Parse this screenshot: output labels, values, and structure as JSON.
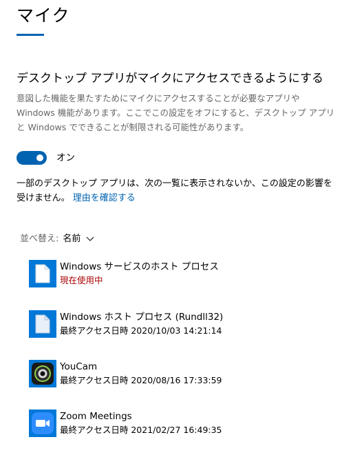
{
  "page": {
    "title": "マイク"
  },
  "desktop_access": {
    "heading": "デスクトップ アプリがマイクにアクセスできるようにする",
    "description": "意図した機能を果たすためにマイクにアクセスすることが必要なアプリや Windows 機能があります。ここでこの設定をオフにすると、デスクトップ アプリと Windows でできることが制限される可能性があります。",
    "toggle_state": "オン",
    "toggle_on": true,
    "note_text": "一部のデスクトップ アプリは、次の一覧に表示されないか、この設定の影響を受けません。",
    "note_link": "理由を確認する"
  },
  "sort": {
    "label": "並べ替え:",
    "value": "名前"
  },
  "apps": [
    {
      "name": "Windows サービスのホスト プロセス",
      "status": "現在使用中",
      "icon": "document-icon",
      "active": true
    },
    {
      "name": "Windows ホスト プロセス (Rundll32)",
      "status": "最終アクセス日時 2020/10/03 14:21:14",
      "icon": "document-icon",
      "active": false
    },
    {
      "name": "YouCam",
      "status": "最終アクセス日時 2020/08/16 17:33:59",
      "icon": "webcam-icon",
      "active": false
    },
    {
      "name": "Zoom Meetings",
      "status": "最終アクセス日時 2021/02/27 16:49:35",
      "icon": "video-camera-icon",
      "active": false
    }
  ],
  "colors": {
    "accent": "#0063b1",
    "active_status": "#a80000",
    "tile": "#0078d7"
  }
}
